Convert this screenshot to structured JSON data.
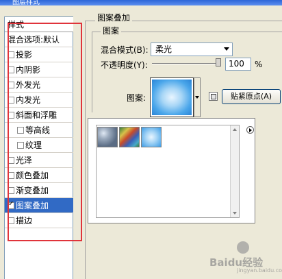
{
  "window": {
    "title": "图层样式"
  },
  "styles_panel": {
    "header": "样式",
    "blend_default": "混合选项:默认",
    "items": [
      {
        "label": "投影",
        "checked": false,
        "indent": false
      },
      {
        "label": "内阴影",
        "checked": false,
        "indent": false
      },
      {
        "label": "外发光",
        "checked": false,
        "indent": false
      },
      {
        "label": "内发光",
        "checked": false,
        "indent": false
      },
      {
        "label": "斜面和浮雕",
        "checked": false,
        "indent": false
      },
      {
        "label": "等高线",
        "checked": false,
        "indent": true
      },
      {
        "label": "纹理",
        "checked": false,
        "indent": true
      },
      {
        "label": "光泽",
        "checked": false,
        "indent": false
      },
      {
        "label": "颜色叠加",
        "checked": false,
        "indent": false
      },
      {
        "label": "渐变叠加",
        "checked": false,
        "indent": false
      },
      {
        "label": "图案叠加",
        "checked": true,
        "indent": false,
        "selected": true
      },
      {
        "label": "描边",
        "checked": false,
        "indent": false
      }
    ]
  },
  "pattern_overlay": {
    "group_title": "图案叠加",
    "sub_group_title": "图案",
    "blend_mode_label": "混合模式(B):",
    "blend_mode_value": "柔光",
    "opacity_label": "不透明度(Y):",
    "opacity_value": "100",
    "opacity_unit": "%",
    "opacity_level": 1.0,
    "pattern_label": "图案:",
    "snap_button": "贴紧原点(A)"
  },
  "pattern_picker": {
    "thumbnails": [
      "bubbles-pattern",
      "rainbow-pattern",
      "blue-pattern"
    ]
  },
  "watermark": {
    "text": "Baidu经验",
    "sub": "jingyan.baidu.com"
  },
  "colors": {
    "selection": "#316ac5",
    "highlight_box": "#e0343b"
  }
}
